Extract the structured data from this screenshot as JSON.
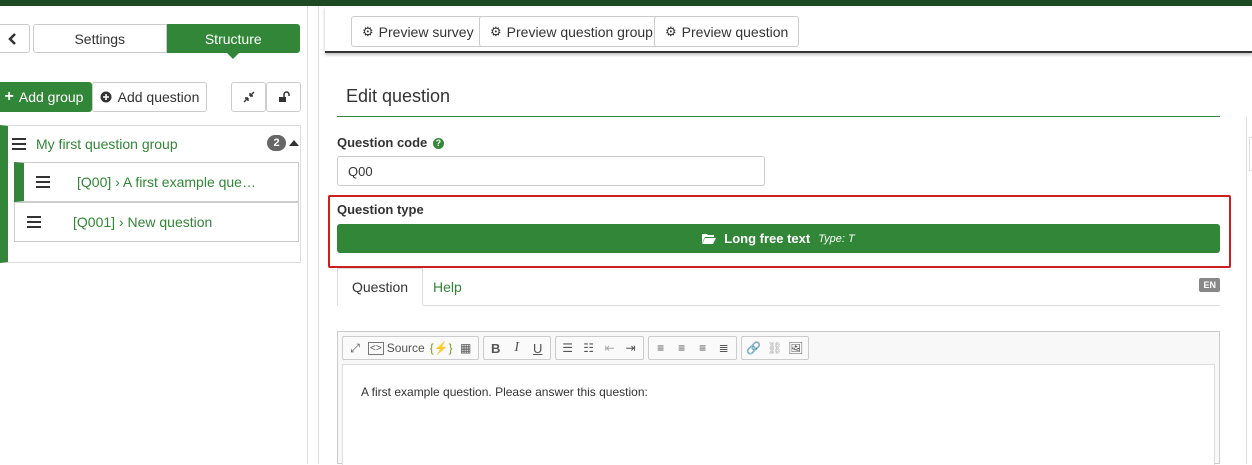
{
  "sidebar": {
    "tabs": [
      {
        "label": "Settings"
      },
      {
        "label": "Structure"
      }
    ],
    "add_group_label": "Add group",
    "add_question_label": "Add question",
    "groups": [
      {
        "label": "My first question group",
        "count": "2",
        "questions": [
          {
            "label": "[Q00] › A first example que…"
          },
          {
            "label": "[Q001] › New question"
          }
        ]
      }
    ]
  },
  "preview": {
    "survey_label": "Preview survey",
    "group_label": "Preview question group",
    "question_label": "Preview question"
  },
  "main": {
    "title": "Edit question",
    "question_code_label": "Question code",
    "question_code_value": "Q00",
    "question_type_label": "Question type",
    "question_type_value": "Long free text",
    "question_type_meta": "Type: T",
    "tabs": [
      {
        "label": "Question"
      },
      {
        "label": "Help"
      }
    ],
    "language_badge": "EN",
    "editor": {
      "source_label": "Source",
      "content": "A first example question. Please answer this question:"
    }
  },
  "colors": {
    "accent": "#328637",
    "topbar": "#1d4a23",
    "highlight": "#cc1f1f"
  }
}
